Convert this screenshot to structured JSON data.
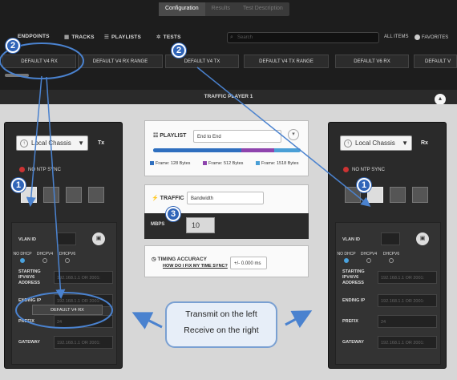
{
  "mode_tabs": [
    "Configuration",
    "Results",
    "Test Description"
  ],
  "nav": {
    "endpoints": "ENDPOINTS",
    "tracks": "TRACKS",
    "playlists": "PLAYLISTS",
    "tests": "TESTS",
    "search_placeholder": "Search",
    "all_items": "ALL ITEMS",
    "favorites": "FAVORITES"
  },
  "endpoint_cards": [
    "DEFAULT V4 RX",
    "DEFAULT V4 RX RANGE",
    "DEFAULT V4 TX",
    "DEFAULT V4 TX RANGE",
    "DEFAULT V6 RX",
    "DEFAULT V"
  ],
  "traffic_player_title": "TRAFFIC PLAYER 1",
  "left_port": {
    "chassis": "Local Chassis",
    "direction": "Tx",
    "ntp": "NO NTP SYNC",
    "vlan_label": "VLAN ID",
    "addr_modes": [
      "NO DHCP",
      "DHCPV4",
      "DHCPV6"
    ],
    "starting_ip_label": "STARTING IPV4/V6 ADDRESS",
    "starting_ip_placeholder": "192.168.1.1 OR 2001:",
    "ending_ip_label": "ENDING IP",
    "ending_ip_placeholder": "192.168.1.1 OR 2001:",
    "prefix_label": "PREFIX",
    "prefix_value": "24",
    "gateway_label": "GATEWAY",
    "gateway_placeholder": "192.168.1.1 OR 2001:",
    "drag_chip": "DEFAULT V4 RX"
  },
  "right_port": {
    "chassis": "Local Chassis",
    "direction": "Rx",
    "ntp": "NO NTP SYNC",
    "vlan_label": "VLAN ID",
    "addr_modes": [
      "NO DHCP",
      "DHCPV4",
      "DHCPV6"
    ],
    "starting_ip_label": "STARTING IPV4/V6 ADDRESS",
    "starting_ip_placeholder": "192.168.1.1 OR 2001:",
    "ending_ip_label": "ENDING IP",
    "ending_ip_placeholder": "192.168.1.1 OR 2001:",
    "prefix_label": "PREFIX",
    "prefix_value": "24",
    "gateway_label": "GATEWAY",
    "gateway_placeholder": "192.168.1.1 OR 2001:"
  },
  "playlist": {
    "title": "PLAYLIST",
    "mode": "End to End",
    "legend": [
      "Frame: 128 Bytes",
      "Frame: 512 Bytes",
      "Frame: 1518 Bytes"
    ],
    "segment_colors": [
      "#2f6fbf",
      "#8e44ad",
      "#4a9fd6"
    ],
    "segment_fractions": [
      0.6,
      0.22,
      0.18
    ]
  },
  "traffic": {
    "title": "TRAFFIC",
    "mode": "Bandwidth",
    "mbps_label": "MBPS",
    "mbps_value": "10"
  },
  "timing": {
    "title": "TIMING ACCURACY",
    "link": "HOW DO I FIX MY TIME SYNC?",
    "value": "+/- 0.000 ms"
  },
  "callout": {
    "line1": "Transmit on the left",
    "line2": "Receive on the right"
  },
  "badges": [
    "1",
    "2",
    "3",
    "1",
    "2"
  ]
}
